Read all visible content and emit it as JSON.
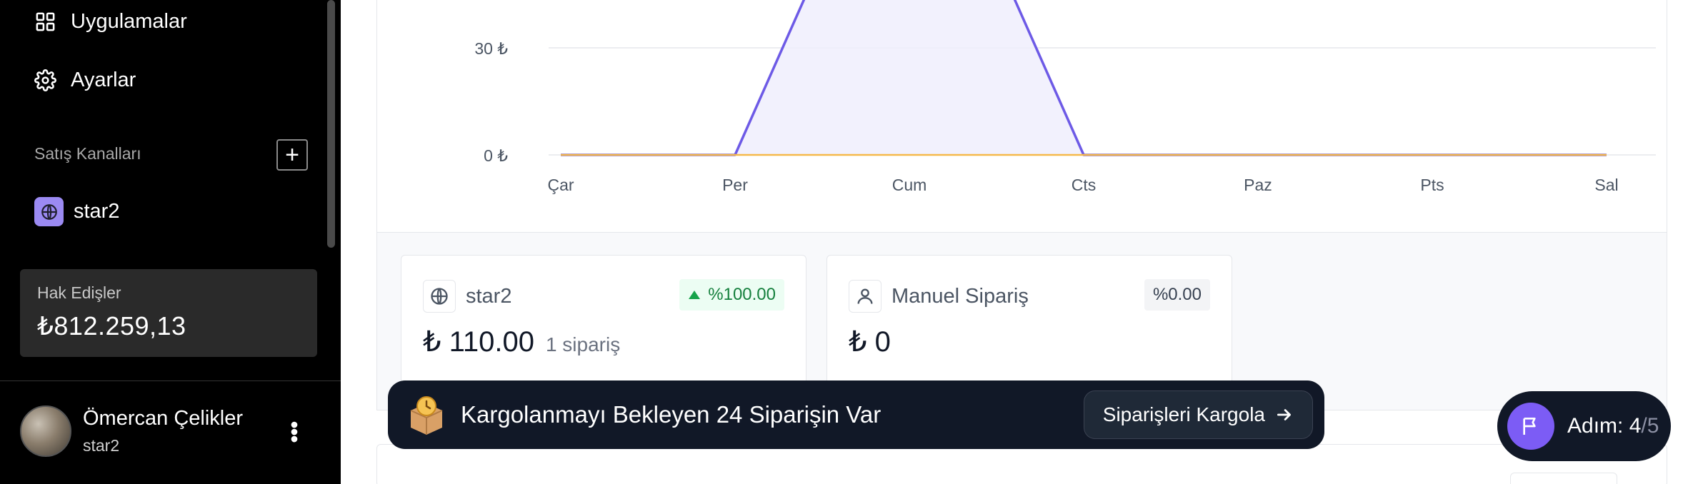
{
  "sidebar": {
    "nav": [
      {
        "label": "Uygulamalar",
        "icon": "grid-icon"
      },
      {
        "label": "Ayarlar",
        "icon": "gear-icon"
      }
    ],
    "sales_channels_label": "Satış Kanalları",
    "add_icon": "plus-icon",
    "channel": {
      "label": "star2",
      "icon": "globe-icon",
      "icon_bg": "#9b8af2"
    },
    "balance": {
      "label": "Hak Edişler",
      "value": "₺812.259,13"
    },
    "user": {
      "name": "Ömercan Çelikler",
      "store": "star2"
    }
  },
  "chart_data": {
    "type": "area",
    "title": "",
    "xlabel": "",
    "ylabel": "",
    "categories": [
      "Çar",
      "Per",
      "Cum",
      "Cts",
      "Paz",
      "Pts",
      "Sal"
    ],
    "y_ticks": [
      "30 ₺",
      "0 ₺"
    ],
    "series": [
      {
        "color": "#6d5ae6",
        "values": [
          0,
          0,
          110,
          0,
          0,
          0,
          0
        ]
      },
      {
        "color": "#f5b94a",
        "values": [
          0,
          0,
          0,
          0,
          0,
          0,
          0
        ]
      }
    ],
    "ylim": [
      0,
      50
    ],
    "grid": true
  },
  "stats": [
    {
      "title": "star2",
      "icon": "globe-icon",
      "badge": "%100.00",
      "badge_trend": "up",
      "amount": "₺ 110.00",
      "count": "1 sipariş"
    },
    {
      "title": "Manuel Sipariş",
      "icon": "user-icon",
      "badge": "%0.00",
      "badge_trend": "neutral",
      "amount": "₺ 0",
      "count": ""
    }
  ],
  "toast": {
    "icon": "package-clock-icon",
    "text": "Kargolanmayı Bekleyen 24 Siparişin Var",
    "button_label": "Siparişleri Kargola"
  },
  "step": {
    "label": "Adım:",
    "current": "4",
    "total": "/5",
    "icon": "flag-icon",
    "accent": "#7c5cf5"
  }
}
